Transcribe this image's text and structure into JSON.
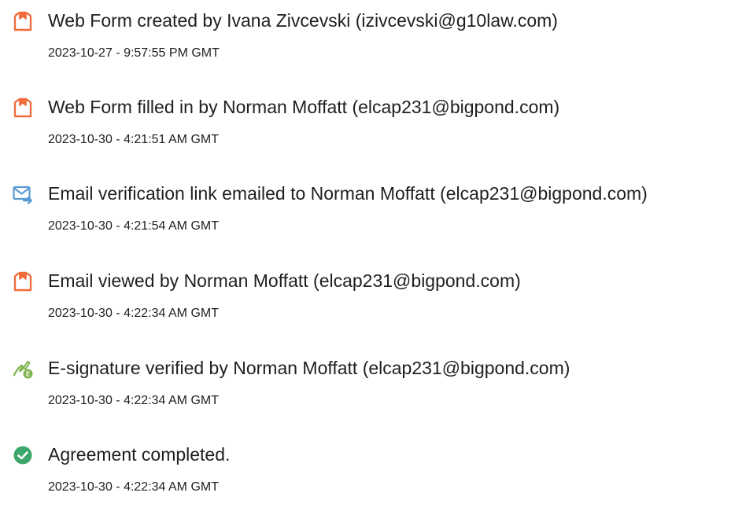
{
  "colors": {
    "form_icon": "#F26B3A",
    "email_icon": "#5B9BD5",
    "signature_icon": "#7DB34A",
    "check_icon": "#3CA66B",
    "text": "#1F1F1F"
  },
  "events": [
    {
      "icon": "web-form-icon",
      "title": "Web Form created by Ivana Zivcevski (izivcevski@g10law.com)",
      "timestamp": "2023-10-27 - 9:57:55 PM GMT"
    },
    {
      "icon": "web-form-icon",
      "title": "Web Form filled in by Norman Moffatt (elcap231@bigpond.com)",
      "timestamp": "2023-10-30 - 4:21:51 AM GMT"
    },
    {
      "icon": "email-sent-icon",
      "title": "Email verification link emailed to Norman Moffatt (elcap231@bigpond.com)",
      "timestamp": "2023-10-30 - 4:21:54 AM GMT"
    },
    {
      "icon": "web-form-icon",
      "title": "Email viewed by Norman Moffatt (elcap231@bigpond.com)",
      "timestamp": "2023-10-30 - 4:22:34 AM GMT"
    },
    {
      "icon": "signature-verified-icon",
      "title": "E-signature verified by Norman Moffatt (elcap231@bigpond.com)",
      "timestamp": "2023-10-30 - 4:22:34 AM GMT"
    },
    {
      "icon": "check-circle-icon",
      "title": "Agreement completed.",
      "timestamp": "2023-10-30 - 4:22:34 AM GMT"
    }
  ]
}
